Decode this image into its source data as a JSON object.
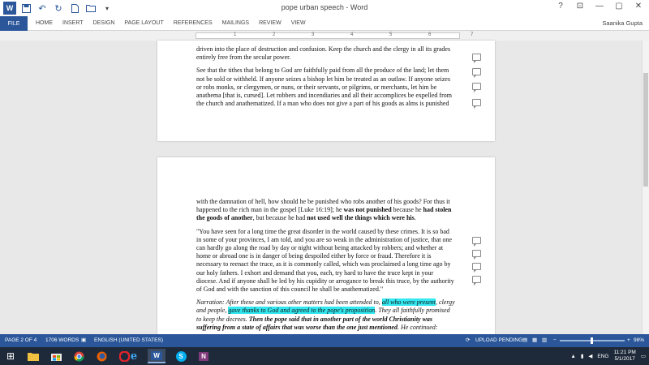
{
  "window": {
    "title": "pope urban speech - Word",
    "minimize": "—",
    "restore": "▢",
    "close": "✕",
    "help": "?",
    "ribbon_options": "⊡"
  },
  "ribbon": {
    "file": "FILE",
    "tabs": [
      "HOME",
      "INSERT",
      "DESIGN",
      "PAGE LAYOUT",
      "REFERENCES",
      "MAILINGS",
      "REVIEW",
      "VIEW"
    ],
    "user": "Saanika Gupta"
  },
  "ruler": {
    "numbers": [
      "1",
      "2",
      "3",
      "4",
      "5",
      "6",
      "7"
    ]
  },
  "page1": {
    "paragraphs": [
      "driven into the place of destruction and confusion. Keep the church and the clergy in all its grades entirely free from the secular power.",
      "See that the tithes that belong to God are faithfully paid from all the produce of the land; let them not be sold or withheld. If anyone seizes a bishop let him be treated as an outlaw. If anyone seizes or robs monks, or clergymen, or nuns, or their servants, or pilgrims, or merchants, let him be anathema [that is, cursed]. Let robbers and incendiaries and all their accomplices be expelled from the church and anathematized. If a man who does not give a part of his goods as alms is punished"
    ]
  },
  "page2": {
    "p1_a": "with the damnation of hell, how should he be punished who robs another of his goods? For thus it happened to the rich man in the gospel [Luke 16:19]; he ",
    "p1_b": "was not punished",
    "p1_c": " because he ",
    "p1_d": "had stolen the goods of another",
    "p1_e": ", but because he had ",
    "p1_f": "not used well the things which were his",
    "p1_g": ".",
    "p2": "\"You have seen for a long time the great disorder in the world caused by these crimes. It is so bad in some of your provinces, I am told, and you are so weak in the administration of justice, that one can hardly go along the road by day or night without being attacked by robbers; and whether at home or abroad one is in danger of being despoiled either by force or fraud. Therefore it is necessary to reenact the truce, as it is commonly called, which was proclaimed a long time ago by our holy fathers. I exhort and demand that you, each, try hard to have the truce kept in your diocese. And if anyone shall be led by his cupidity or arrogance to break this truce, by the authority of God and with the sanction of this council he shall be anathematized.\"",
    "p3_a": "Narration: After these and various other matters had been attended to, ",
    "p3_hl1": "all who were present",
    "p3_b": ", clergy and people, ",
    "p3_hl2": "gave thanks to God and agreed to the pope's proposition",
    "p3_c": ". They all faithfully promised to keep the decrees. ",
    "p3_bold": "Then the pope said that in another part of the world Christianity was suffering from a state of affairs that was worse than the one just mentioned",
    "p3_d": ". He continued:"
  },
  "status": {
    "page": "PAGE 2 OF 4",
    "words": "1706 WORDS",
    "language": "ENGLISH (UNITED STATES)",
    "upload": "UPLOAD PENDING",
    "zoom": "98%",
    "zoom_fraction": 0.49
  },
  "taskbar": {
    "start": "⊞",
    "lang": "ENG",
    "time": "11:21 PM",
    "date": "5/1/2017"
  },
  "colors": {
    "accent": "#2b579a",
    "highlight": "#33e8f0"
  }
}
